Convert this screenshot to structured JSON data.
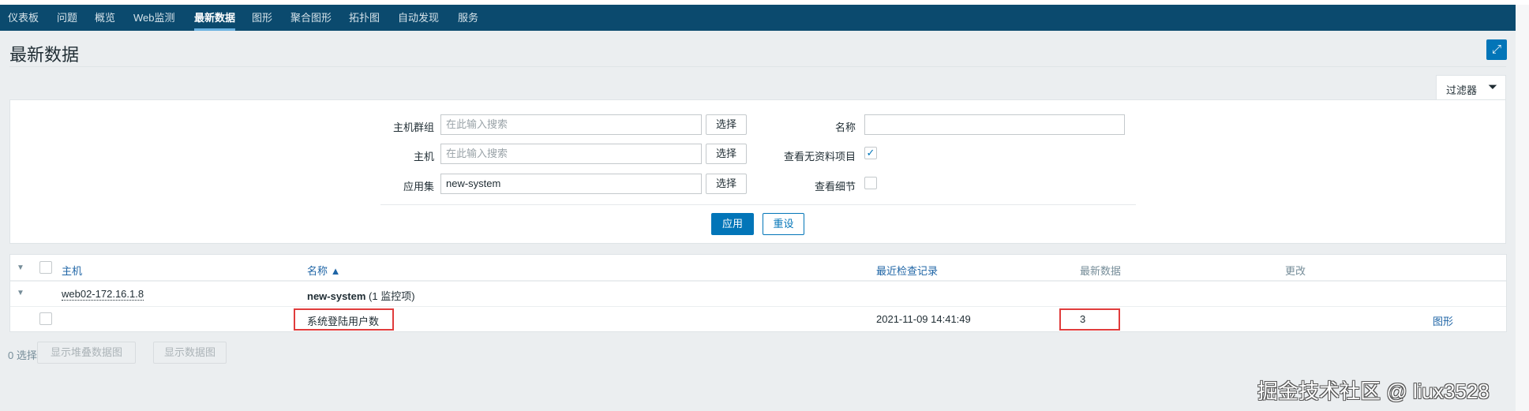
{
  "nav": {
    "items": [
      "仪表板",
      "问题",
      "概览",
      "Web监测",
      "最新数据",
      "图形",
      "聚合图形",
      "拓扑图",
      "自动发现",
      "服务"
    ],
    "active": "最新数据"
  },
  "page": {
    "title": "最新数据"
  },
  "filter": {
    "tab_label": "过滤器",
    "host_group": {
      "label": "主机群组",
      "placeholder": "在此输入搜索",
      "value": ""
    },
    "host": {
      "label": "主机",
      "placeholder": "在此输入搜索",
      "value": ""
    },
    "application": {
      "label": "应用集",
      "value": "new-system"
    },
    "select_label": "选择",
    "name": {
      "label": "名称",
      "value": ""
    },
    "show_no_data": {
      "label": "查看无资料项目",
      "checked": true
    },
    "show_details": {
      "label": "查看细节",
      "checked": false
    },
    "apply_label": "应用",
    "reset_label": "重设"
  },
  "table": {
    "headers": {
      "host": "主机",
      "name": "名称 ▲",
      "last_check": "最近检查记录",
      "last_value": "最新数据",
      "change": "更改"
    },
    "group_row": {
      "host": "web02-172.16.1.8",
      "app": "new-system",
      "count": "(1 监控项)"
    },
    "item_row": {
      "name": "系统登陆用户数",
      "last_check": "2021-11-09 14:41:49",
      "last_value": "3",
      "change": "",
      "action": "图形"
    }
  },
  "footer": {
    "selected": "0 选择",
    "stacked_graph": "显示堆叠数据图",
    "graph": "显示数据图"
  },
  "watermark": "掘金技术社区 @ liux3528",
  "colors": {
    "nav": "#0b4a6e",
    "accent": "#0275b8",
    "highlight": "#e03c3c"
  }
}
